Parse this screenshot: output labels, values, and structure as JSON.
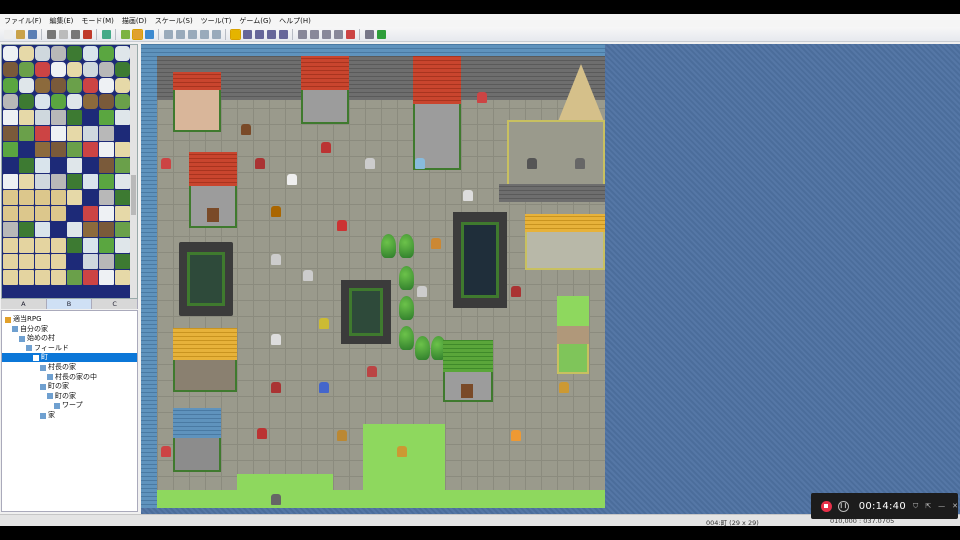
{
  "menu": [
    "ファイル(F)",
    "編集(E)",
    "モード(M)",
    "描画(D)",
    "スケール(S)",
    "ツール(T)",
    "ゲーム(G)",
    "ヘルプ(H)"
  ],
  "palette_tabs": [
    "A",
    "B",
    "C"
  ],
  "map_tree": [
    {
      "label": "適当RPG",
      "level": 0,
      "type": "project"
    },
    {
      "label": "自分の家",
      "level": 1,
      "type": "map"
    },
    {
      "label": "始めの村",
      "level": 2,
      "type": "map"
    },
    {
      "label": "フィールド",
      "level": 3,
      "type": "map"
    },
    {
      "label": "町",
      "level": 4,
      "type": "map",
      "selected": true
    },
    {
      "label": "村長の家",
      "level": 5,
      "type": "map"
    },
    {
      "label": "村長の家の中",
      "level": 6,
      "type": "map"
    },
    {
      "label": "町の家",
      "level": 5,
      "type": "map"
    },
    {
      "label": "町の家",
      "level": 6,
      "type": "map"
    },
    {
      "label": "ワープ",
      "level": 7,
      "type": "map"
    },
    {
      "label": "家",
      "level": 5,
      "type": "map"
    }
  ],
  "status": {
    "map_info": "004:町 (29 x 29)",
    "coords": "010,000 : 037.0705"
  },
  "recorder": {
    "time": "00:14:40"
  },
  "colors": {
    "selection": "#0b77d8",
    "recorder_bg": "#1c1c1c",
    "record_red": "#e8304a",
    "ocean": "#4b6d9b",
    "grass": "#8ed85e"
  }
}
